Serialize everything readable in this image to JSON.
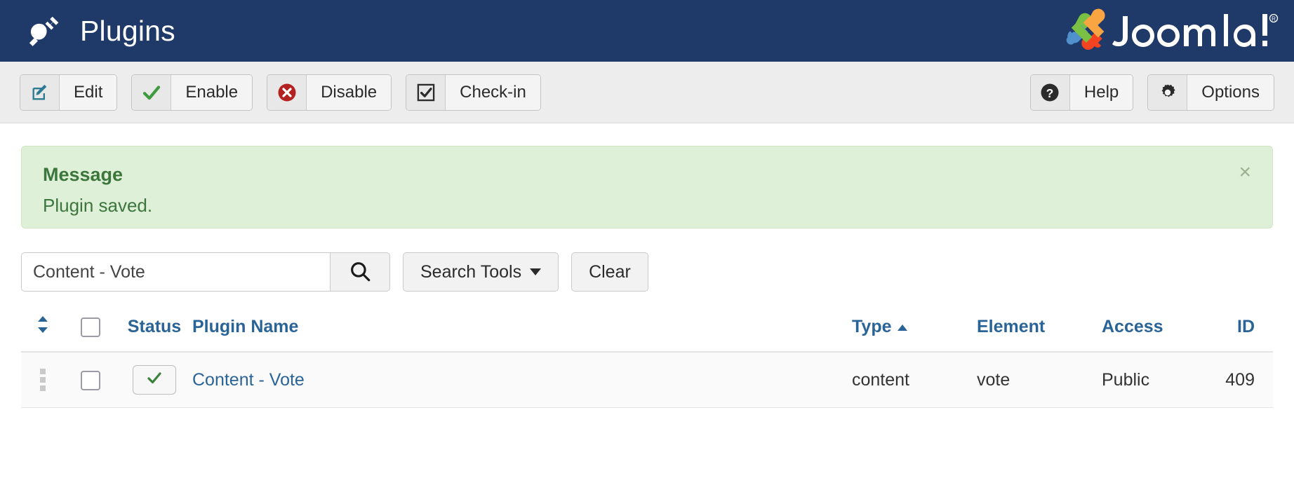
{
  "header": {
    "title": "Plugins",
    "plug_icon": "plug-icon",
    "brand_name": "Joomla!",
    "brand_registered": "®"
  },
  "toolbar": {
    "left_buttons": [
      {
        "label": "Edit",
        "icon": "edit-pencil-square-icon"
      },
      {
        "label": "Enable",
        "icon": "check-mark-icon"
      },
      {
        "label": "Disable",
        "icon": "x-circle-icon"
      },
      {
        "label": "Check-in",
        "icon": "checkbox-checked-icon"
      }
    ],
    "right_buttons": [
      {
        "label": "Help",
        "icon": "question-circle-icon"
      },
      {
        "label": "Options",
        "icon": "gear-icon"
      }
    ]
  },
  "alert": {
    "title": "Message",
    "text": "Plugin saved.",
    "close_label": "×",
    "bg_color": "#dff0d8",
    "text_color": "#3c763d"
  },
  "search": {
    "value": "Content - Vote",
    "placeholder": "Search",
    "search_icon": "magnifier-icon",
    "search_tools_label": "Search Tools",
    "clear_label": "Clear"
  },
  "table": {
    "columns": [
      {
        "key": "handle",
        "label": ""
      },
      {
        "key": "check",
        "label": ""
      },
      {
        "key": "status",
        "label": "Status"
      },
      {
        "key": "name",
        "label": "Plugin Name"
      },
      {
        "key": "type",
        "label": "Type"
      },
      {
        "key": "element",
        "label": "Element"
      },
      {
        "key": "access",
        "label": "Access"
      },
      {
        "key": "id",
        "label": "ID"
      }
    ],
    "sorted_column": "Type",
    "sort_direction": "ascending",
    "rows": [
      {
        "status": "enabled",
        "name": "Content - Vote",
        "type": "content",
        "element": "vote",
        "access": "Public",
        "id": "409"
      }
    ]
  },
  "colors": {
    "header_bg": "#1f3a68",
    "toolbar_bg": "#ededed",
    "link": "#2a6496",
    "enabled_check": "#398439"
  }
}
